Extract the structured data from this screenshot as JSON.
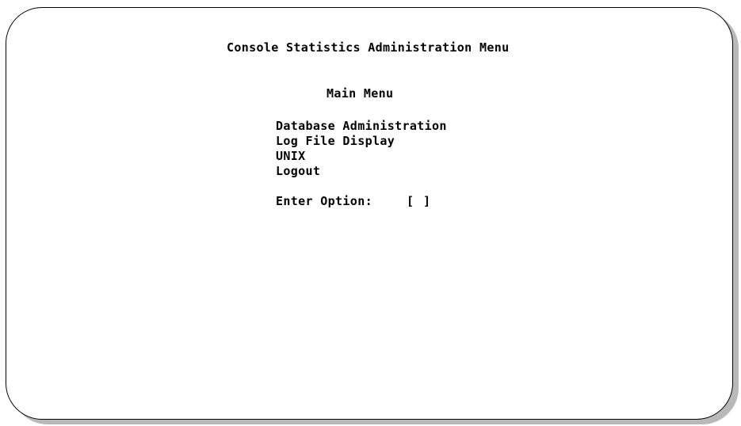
{
  "screen": {
    "title": "Console Statistics Administration Menu",
    "menu_heading": "Main Menu",
    "menu_items": [
      {
        "label": "Database Administration"
      },
      {
        "label": "Log File Display"
      },
      {
        "label": "UNIX"
      },
      {
        "label": "Logout"
      }
    ],
    "prompt": {
      "label": "Enter Option:",
      "bracket_open": "[",
      "value": "",
      "bracket_close": "]"
    }
  },
  "colors": {
    "background": "#ffffff",
    "text": "#000000",
    "border": "#000000",
    "shadow": "#b9b9b9"
  }
}
